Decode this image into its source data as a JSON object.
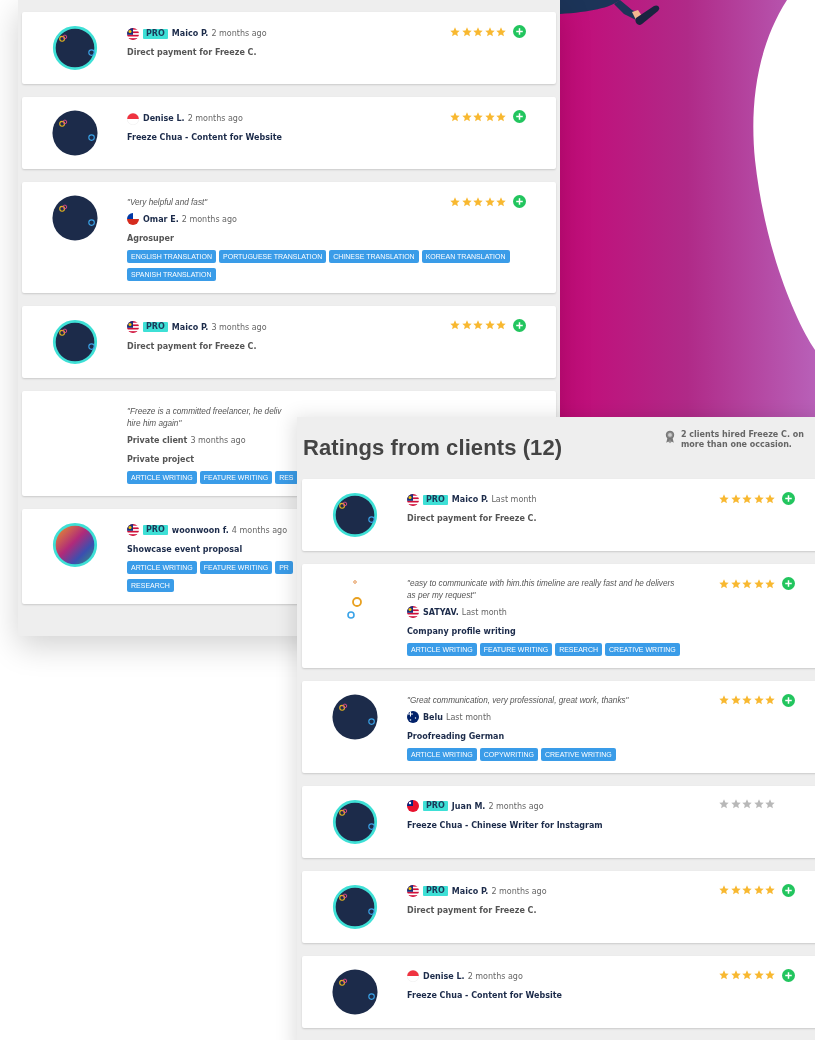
{
  "left_panel": {
    "reviews": [
      {
        "avatar": {
          "kind": "logo"
        },
        "flag": {
          "kind": "my"
        },
        "badge": "PRO",
        "name": "Maico P.",
        "time": "2 months ago",
        "project": "Direct payment for Freeze C.",
        "linked": false,
        "stars": 5,
        "tip": true
      },
      {
        "avatar": {
          "kind": "logo"
        },
        "flag": {
          "kind": "sg"
        },
        "name": "Denise L.",
        "time": "2 months ago",
        "project": "Freeze Chua - Content for Website",
        "linked": true,
        "stars": 5,
        "tip": true
      },
      {
        "avatar": {
          "kind": "logo"
        },
        "quote_lines": [
          "\"Very helpful and fast\""
        ],
        "flag": {
          "kind": "cl"
        },
        "name": "Omar E.",
        "time": "2 months ago",
        "project": "Agrosuper",
        "linked": false,
        "stars": 5,
        "tip": true,
        "tag_rows": [
          [
            "ENGLISH TRANSLATION",
            "PORTUGUESE TRANSLATION",
            "CHINESE TRANSLATION",
            "KOREAN TRANSLATION"
          ],
          [
            "SPANISH TRANSLATION"
          ]
        ]
      },
      {
        "avatar": {
          "kind": "logo"
        },
        "flag": {
          "kind": "my"
        },
        "badge": "PRO",
        "name": "Maico P.",
        "time": "3 months ago",
        "project": "Direct payment for Freeze C.",
        "linked": false,
        "stars": 5,
        "tip": true
      },
      {
        "avatar": {
          "kind": "none"
        },
        "quote_lines": [
          "\"Freeze is a committed freelancer, he deliv",
          "hire him again\""
        ],
        "name": "Private client",
        "time": "3 months ago",
        "project": "Private project",
        "linked": false,
        "tag_rows": [
          [
            "ARTICLE WRITING",
            "FEATURE WRITING",
            "RES"
          ]
        ]
      },
      {
        "avatar": {
          "kind": "gradient"
        },
        "flag": {
          "kind": "my"
        },
        "badge": "PRO",
        "name": "woonwoon f.",
        "time": "4 months ago",
        "project": "Showcase event proposal",
        "linked": true,
        "tag_rows": [
          [
            "ARTICLE WRITING",
            "FEATURE WRITING",
            "PR"
          ],
          [
            "RESEARCH"
          ]
        ]
      }
    ]
  },
  "right_panel": {
    "title": "Ratings from clients (12)",
    "repeat_note": "2 clients hired Freeze C. on more than one occasion.",
    "reviews": [
      {
        "avatar": {
          "kind": "logo"
        },
        "flag": {
          "kind": "my"
        },
        "badge": "PRO",
        "name": "Maico P.",
        "time": "Last month",
        "project": "Direct payment for Freeze C.",
        "linked": false,
        "stars": 5,
        "tip": true
      },
      {
        "avatar": {
          "kind": "rings"
        },
        "quote_lines": [
          "\"easy to communicate with him.this timeline are really fast and he delivers",
          "as per my request\""
        ],
        "flag": {
          "kind": "my"
        },
        "name": "SATYAV.",
        "time": "Last month",
        "project": "Company profile writing",
        "linked": true,
        "stars": 5,
        "tip": true,
        "tag_rows": [
          [
            "ARTICLE WRITING",
            "FEATURE WRITING",
            "RESEARCH",
            "CREATIVE WRITING"
          ]
        ]
      },
      {
        "avatar": {
          "kind": "logo"
        },
        "quote_lines": [
          "\"Great communication, very professional, great work, thanks\""
        ],
        "flag": {
          "kind": "au"
        },
        "name": "Belu",
        "time": "Last month",
        "project": "Proofreading German",
        "linked": true,
        "stars": 5,
        "tip": true,
        "tag_rows": [
          [
            "ARTICLE WRITING",
            "COPYWRITING",
            "CREATIVE WRITING"
          ]
        ]
      },
      {
        "avatar": {
          "kind": "logo"
        },
        "flag": {
          "kind": "tw"
        },
        "badge": "PRO",
        "name": "Juan M.",
        "time": "2 months ago",
        "project": "Freeze Chua - Chinese Writer for Instagram",
        "linked": true,
        "stars": 0,
        "tip": false
      },
      {
        "avatar": {
          "kind": "logo"
        },
        "flag": {
          "kind": "my"
        },
        "badge": "PRO",
        "name": "Maico P.",
        "time": "2 months ago",
        "project": "Direct payment for Freeze C.",
        "linked": false,
        "stars": 5,
        "tip": true
      },
      {
        "avatar": {
          "kind": "logo"
        },
        "flag": {
          "kind": "sg"
        },
        "name": "Denise L.",
        "time": "2 months ago",
        "project": "Freeze Chua - Content for Website",
        "linked": true,
        "stars": 5,
        "tip": true
      }
    ]
  }
}
